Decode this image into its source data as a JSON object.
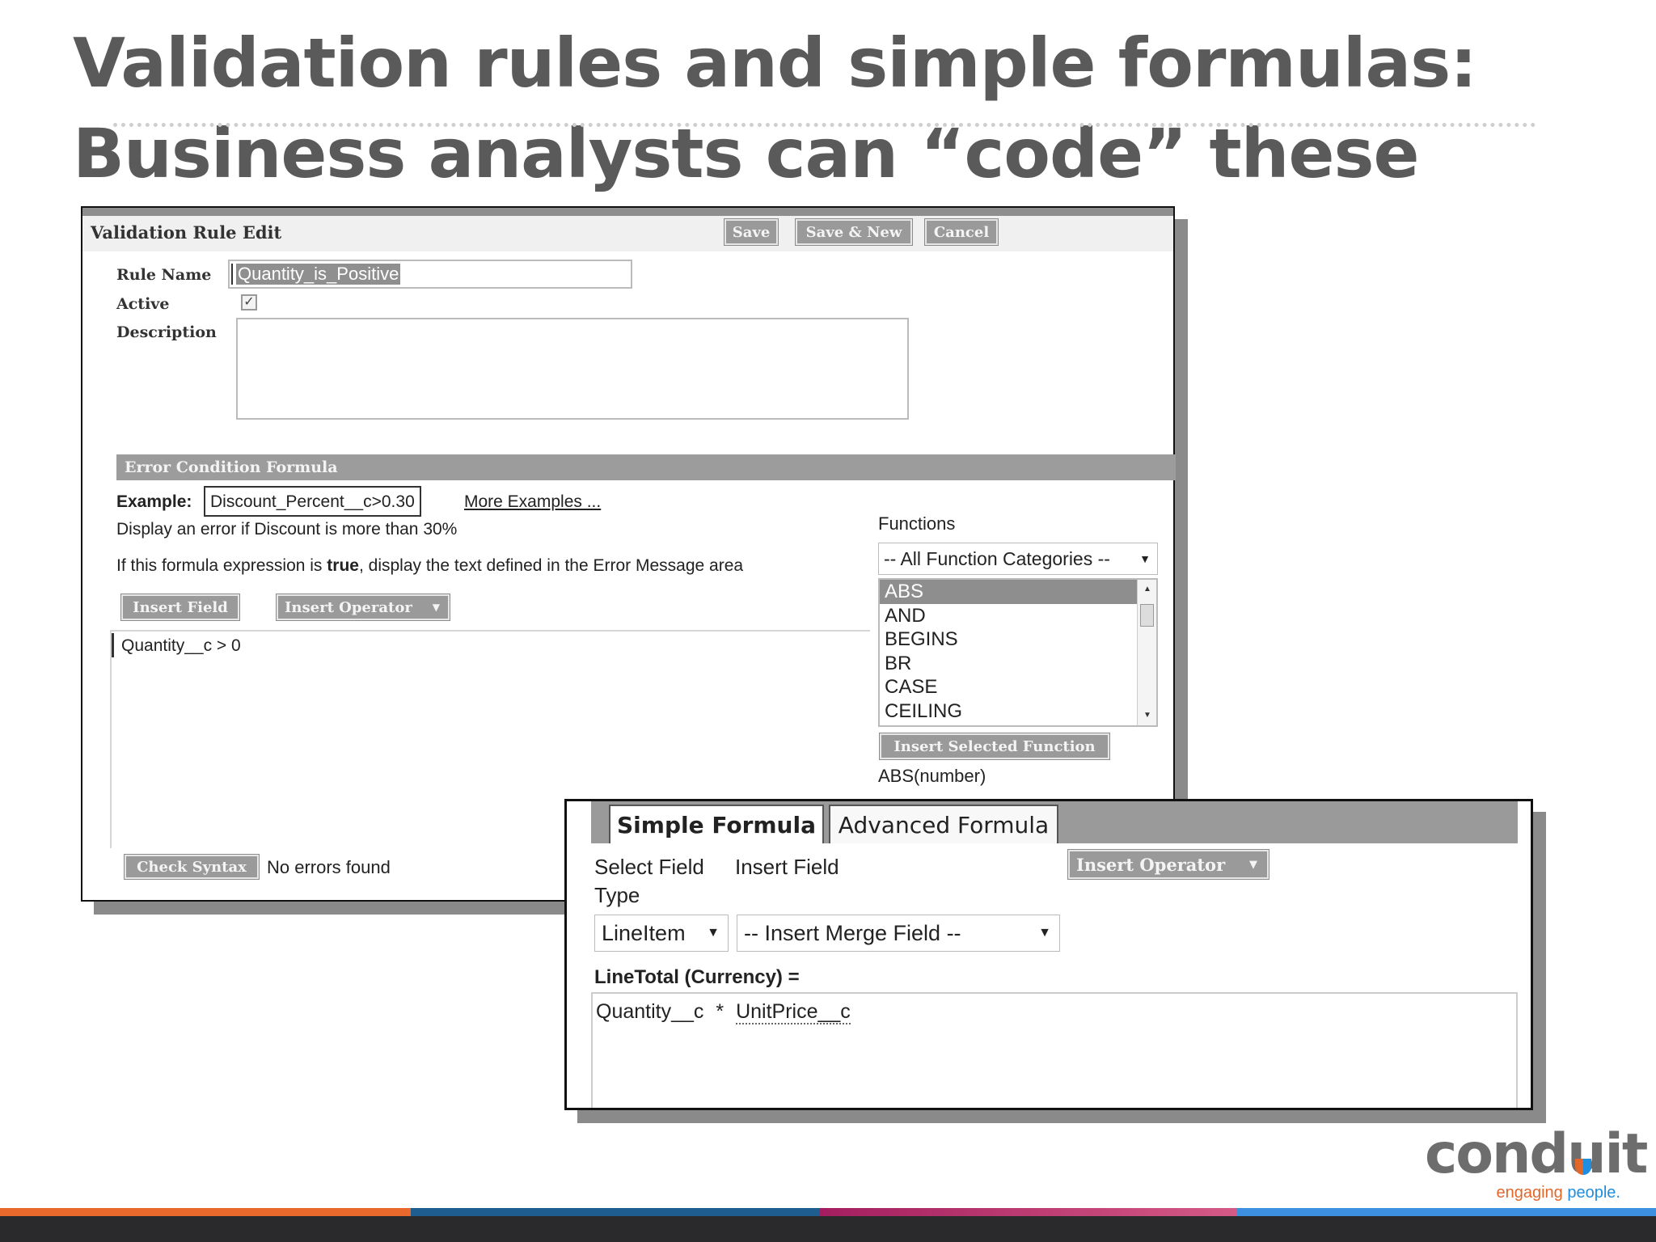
{
  "slide": {
    "title_line1": "Validation rules and simple formulas:",
    "title_line2": "Business analysts can “code” these"
  },
  "validation_window": {
    "header_title": "Validation Rule Edit",
    "buttons": {
      "save": "Save",
      "save_new": "Save & New",
      "cancel": "Cancel"
    },
    "rule_name_label": "Rule Name",
    "rule_name_value": "Quantity_is_Positive",
    "active_label": "Active",
    "active_checked": true,
    "description_label": "Description",
    "description_value": "",
    "section_title": "Error Condition Formula",
    "example_label": "Example:",
    "example_value": "Discount_Percent__c>0.30",
    "more_examples_link": "More Examples ...",
    "example_help": "Display an error if Discount is more than 30%",
    "formula_help_before": "If this formula expression is",
    "formula_help_bold": "true",
    "formula_help_after": ", display the text defined in the Error Message area",
    "insert_field_btn": "Insert Field",
    "insert_operator_btn": "Insert Operator",
    "formula_text": "Quantity__c > 0",
    "check_syntax_btn": "Check Syntax",
    "syntax_status": "No errors found",
    "functions_label": "Functions",
    "function_category": "-- All Function Categories --",
    "functions": [
      "ABS",
      "AND",
      "BEGINS",
      "BR",
      "CASE",
      "CEILING"
    ],
    "selected_function": "ABS",
    "insert_function_btn": "Insert Selected Function",
    "function_signature": "ABS(number)"
  },
  "formula_window": {
    "tabs": [
      "Simple Formula",
      "Advanced Formula"
    ],
    "active_tab": "Simple Formula",
    "select_field_type_label_1": "Select Field",
    "select_field_type_label_2": "Type",
    "insert_field_label": "Insert Field",
    "insert_operator_btn": "Insert Operator",
    "field_type_value": "LineItem",
    "merge_field_value": "-- Insert Merge Field --",
    "formula_label": "LineTotal (Currency) =",
    "formula_left": "Quantity__c",
    "formula_operator": "*",
    "formula_right": "UnitPrice__c"
  },
  "logo": {
    "word_start": "cond",
    "word_u": "u",
    "word_end": "it",
    "tag_word1": "engaging",
    "tag_word2": "people."
  },
  "colors": {
    "title": "#5a5a5a",
    "button_grey": "#9a9a9a",
    "logo_orange": "#e2672a",
    "logo_blue": "#1f8ee0",
    "footer_orange": "#e8692b",
    "footer_navy": "#1d5d8f",
    "footer_magenta": "#a41e5f",
    "footer_blue": "#3d8fe0",
    "footer_dark": "#2a2a2d"
  }
}
